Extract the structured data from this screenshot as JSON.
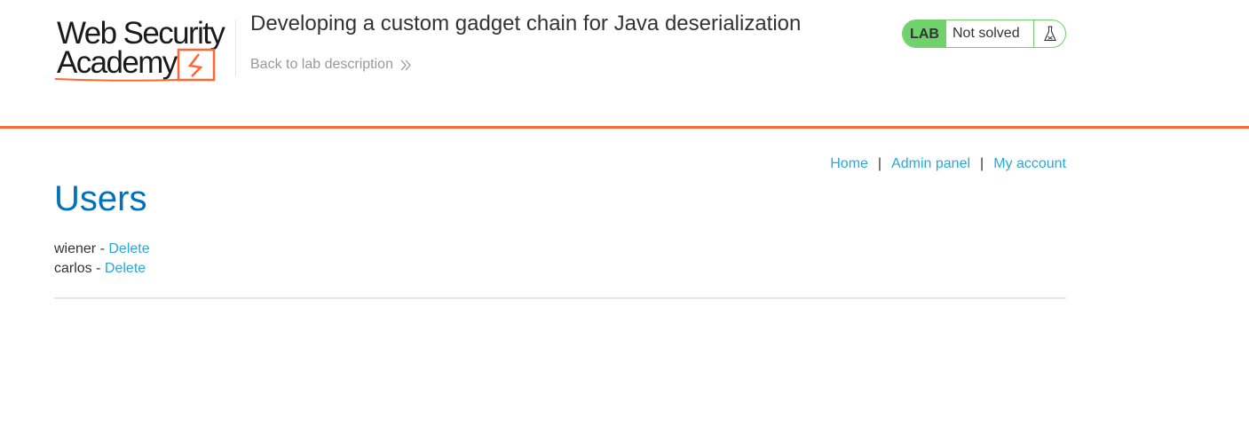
{
  "logo": {
    "line1": "Web Security",
    "line2": "Academy"
  },
  "lab": {
    "title": "Developing a custom gadget chain for Java deserialization",
    "back_link": "Back to lab description",
    "badge": "LAB",
    "status": "Not solved"
  },
  "nav": {
    "home": "Home",
    "separator": "|",
    "admin": "Admin panel",
    "account": "My account"
  },
  "page": {
    "heading": "Users"
  },
  "users": [
    {
      "name": "wiener",
      "separator": " - ",
      "action": "Delete"
    },
    {
      "name": "carlos",
      "separator": " - ",
      "action": "Delete"
    }
  ],
  "colors": {
    "accent": "#ff6633",
    "heading": "#0071bc",
    "link": "#29a8db",
    "status_green": "#70d16d"
  },
  "icons": {
    "back": "double-chevron-right-icon",
    "status": "flask-icon",
    "logo_mark": "lightning-bolt-icon"
  }
}
